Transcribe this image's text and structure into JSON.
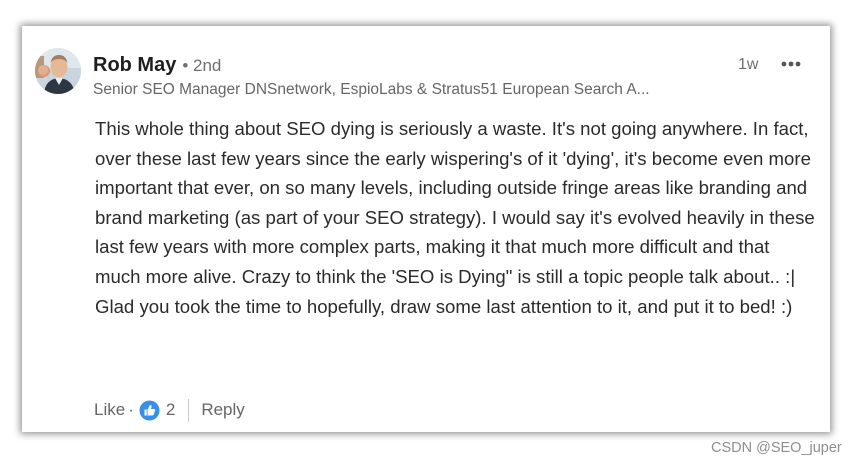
{
  "comment": {
    "author": {
      "name": "Rob May",
      "degree": "• 2nd",
      "headline": "Senior SEO Manager DNSnetwork, EspioLabs & Stratus51 European Search A...",
      "avatar_icon": "profile-photo"
    },
    "timestamp": "1w",
    "more_icon": "ellipsis-icon",
    "text": "This whole thing about SEO dying is seriously a waste. It's not going anywhere. In fact, over these last few years since the early wispering's of it 'dying', it's become even more important that ever, on so many levels, including outside fringe areas like branding and brand marketing (as part of your SEO strategy). I would say it's evolved heavily in these last few years with more complex parts, making it that much more difficult and that much more alive. Crazy to think the 'SEO is Dying\" is still a topic people talk about.. :| Glad you took the time to hopefully, draw some last attention to it, and put it to bed! :)",
    "actions": {
      "like_label": "Like",
      "dot": "·",
      "reaction_icon": "thumbs-up-icon",
      "reaction_count": "2",
      "reply_label": "Reply"
    }
  },
  "watermark": "CSDN @SEO_juper",
  "colors": {
    "reaction_blue": "#378fe9",
    "text_primary": "#2b2b2b",
    "text_secondary": "#666666"
  }
}
